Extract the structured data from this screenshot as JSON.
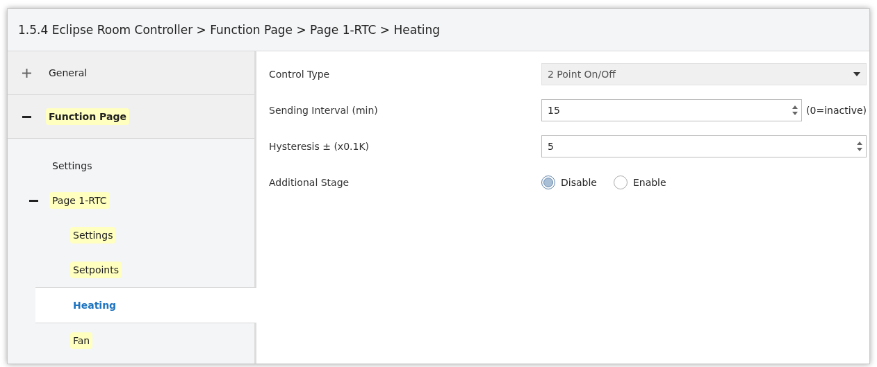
{
  "window": {
    "title": "1.5.4 Eclipse Room Controller > Function Page > Page 1-RTC > Heating"
  },
  "sidebar": {
    "items": [
      {
        "label": "General",
        "expanded": false,
        "highlighted": false
      },
      {
        "label": "Function Page",
        "expanded": true,
        "highlighted": true,
        "children": [
          {
            "label": "Settings",
            "highlighted": false,
            "selected": false
          },
          {
            "label": "Page 1-RTC",
            "expanded": true,
            "highlighted": true,
            "selected": false,
            "children": [
              {
                "label": "Settings",
                "highlighted": true,
                "selected": false
              },
              {
                "label": "Setpoints",
                "highlighted": true,
                "selected": false
              },
              {
                "label": "Heating",
                "highlighted": false,
                "selected": true
              },
              {
                "label": "Fan",
                "highlighted": true,
                "selected": false
              }
            ]
          }
        ]
      }
    ]
  },
  "parameters": [
    {
      "kind": "dropdown",
      "label": "Control Type",
      "value": "2 Point On/Off"
    },
    {
      "kind": "spinner",
      "label": "Sending Interval (min)",
      "value": "15",
      "suffix": "(0=inactive)"
    },
    {
      "kind": "spinner",
      "label": "Hysteresis ± (x0.1K)",
      "value": "5"
    },
    {
      "kind": "radio",
      "label": "Additional Stage",
      "options": [
        {
          "label": "Disable",
          "selected": true
        },
        {
          "label": "Enable",
          "selected": false
        }
      ]
    }
  ]
}
